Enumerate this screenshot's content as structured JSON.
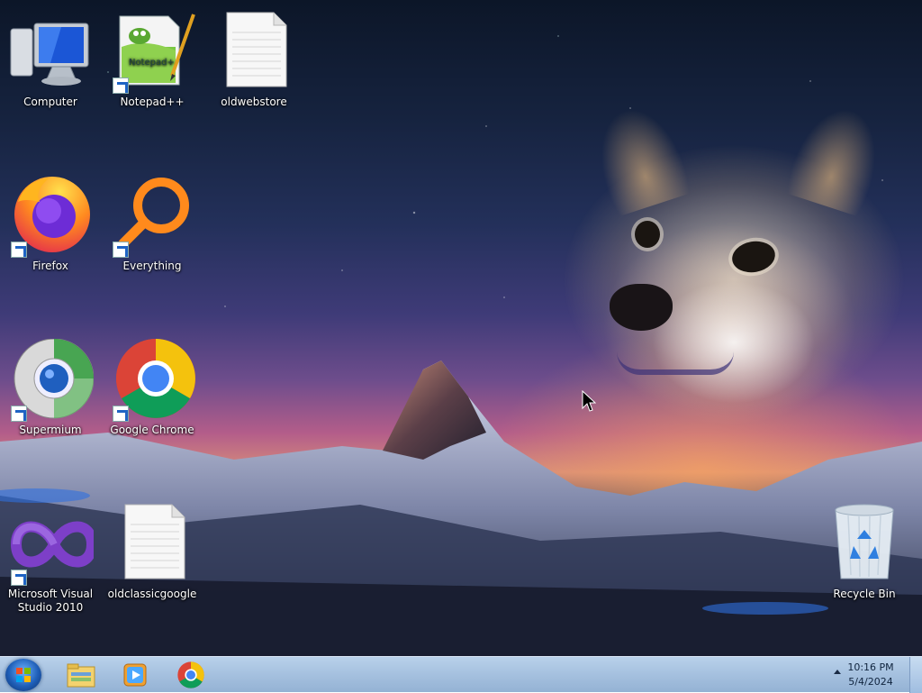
{
  "desktop": {
    "icons": {
      "computer": "Computer",
      "notepad": "Notepad++",
      "oldwebstore": "oldwebstore",
      "firefox": "Firefox",
      "everything": "Everything",
      "supermium": "Supermium",
      "chrome": "Google Chrome",
      "visual_studio": "Microsoft Visual Studio 2010",
      "oldclassicgoogle": "oldclassicgoogle",
      "recycle_bin": "Recycle Bin"
    }
  },
  "taskbar": {
    "pinned": [
      "windows-explorer-icon",
      "windows-media-player-icon",
      "google-chrome-icon"
    ],
    "clock": {
      "time": "10:16 PM",
      "date": "5/4/2024"
    }
  },
  "colors": {
    "taskbar": "#a7c2e0",
    "shortcut_arrow": "#1e63c4"
  }
}
